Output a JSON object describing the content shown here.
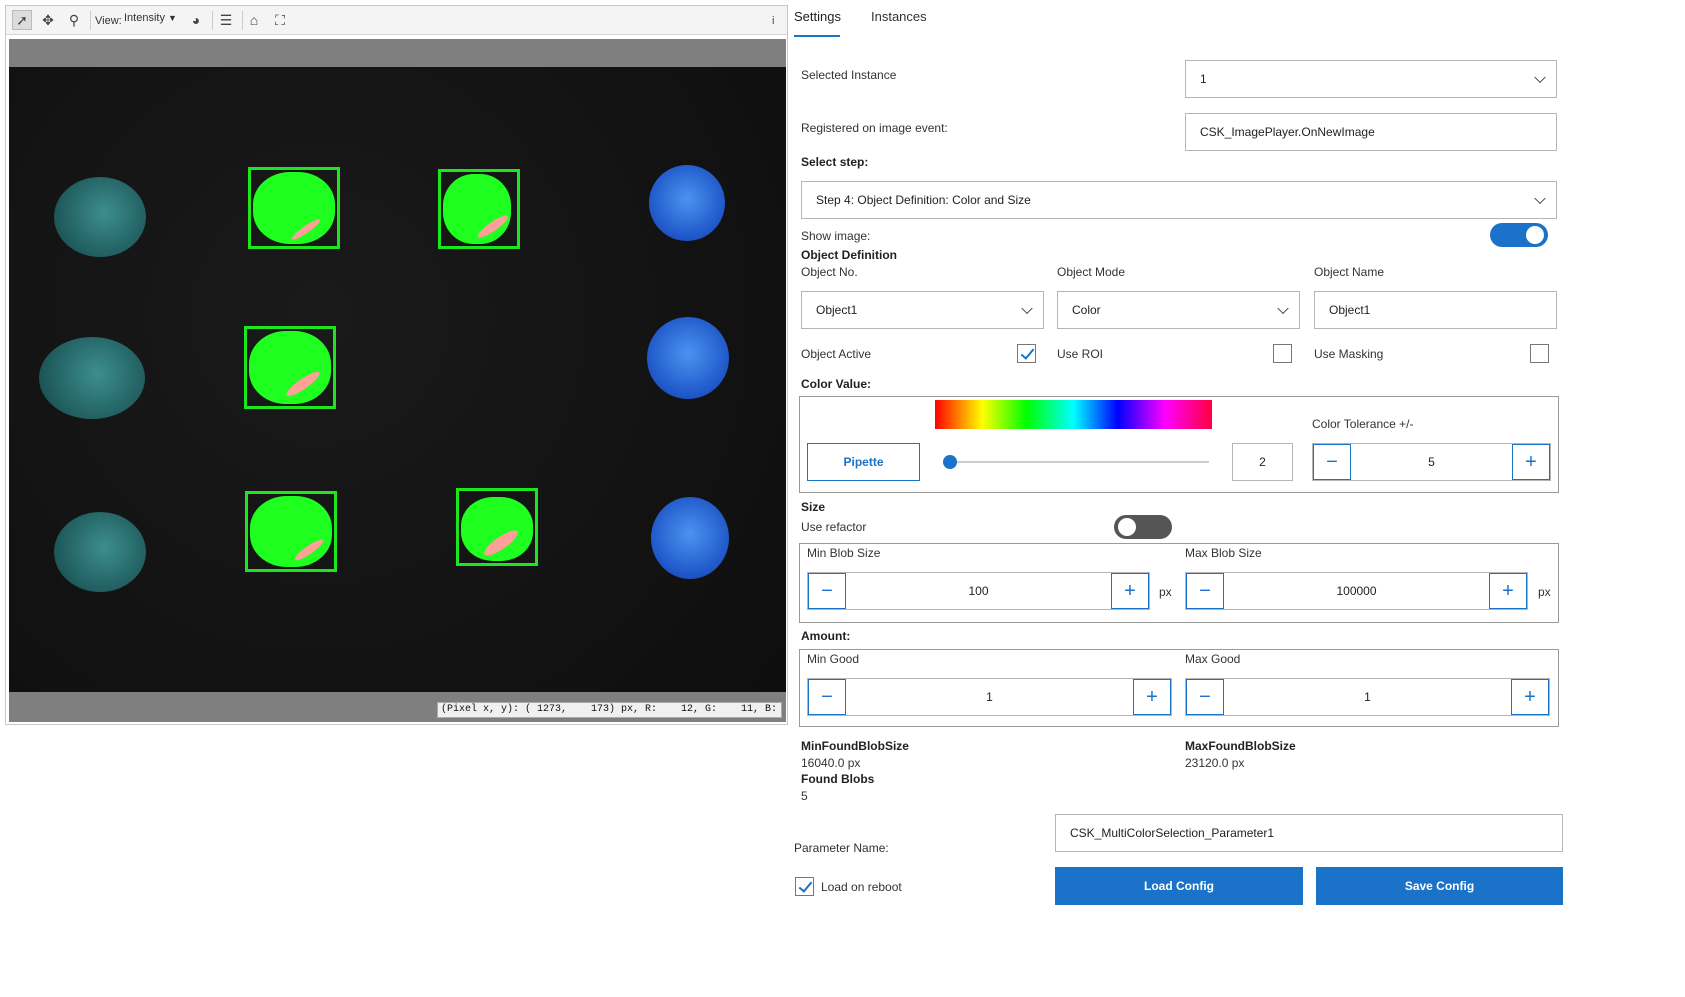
{
  "viewer": {
    "view_label": "View:",
    "view_mode": "Intensity",
    "info_label": "i",
    "status": "(Pixel x, y): ( 1273,    173) px, R:    12, G:    11, B:    17"
  },
  "tabs": [
    {
      "label": "Settings"
    },
    {
      "label": "Instances"
    }
  ],
  "selected_instance": {
    "label": "Selected Instance",
    "value": "1"
  },
  "registered_event": {
    "label": "Registered on image event:",
    "value": "CSK_ImagePlayer.OnNewImage"
  },
  "select_step": {
    "label": "Select step:",
    "value": "Step 4: Object Definition: Color and Size"
  },
  "show_image": {
    "label": "Show image:",
    "on": true
  },
  "object_definition": {
    "title": "Object Definition",
    "object_no_label": "Object No.",
    "object_no_value": "Object1",
    "object_mode_label": "Object Mode",
    "object_mode_value": "Color",
    "object_name_label": "Object Name",
    "object_name_value": "Object1",
    "object_active_label": "Object Active",
    "object_active": true,
    "use_roi_label": "Use ROI",
    "use_roi": false,
    "use_masking_label": "Use Masking",
    "use_masking": false
  },
  "color_value": {
    "title": "Color Value:",
    "pipette_label": "Pipette",
    "hue_value": "2",
    "hue_slider_fraction": 0.0,
    "tolerance_label": "Color Tolerance +/-",
    "tolerance_value": "5"
  },
  "size": {
    "title": "Size",
    "use_refactor_label": "Use refactor",
    "use_refactor": false,
    "min_blob_label": "Min Blob Size",
    "min_blob_value": "100",
    "max_blob_label": "Max Blob Size",
    "max_blob_value": "100000",
    "unit": "px"
  },
  "amount": {
    "title": "Amount:",
    "min_good_label": "Min Good",
    "min_good_value": "1",
    "max_good_label": "Max Good",
    "max_good_value": "1"
  },
  "results": {
    "min_found_label": "MinFoundBlobSize",
    "min_found_value": "16040.0 px",
    "max_found_label": "MaxFoundBlobSize",
    "max_found_value": "23120.0 px",
    "found_blobs_label": "Found Blobs",
    "found_blobs_value": "5"
  },
  "parameter": {
    "label": "Parameter Name:",
    "value": "CSK_MultiColorSelection_Parameter1",
    "load_on_reboot_label": "Load on reboot",
    "load_on_reboot": true,
    "load_button": "Load Config",
    "save_button": "Save Config"
  },
  "icons": {
    "minus": "−",
    "plus": "+"
  },
  "colors": {
    "accent": "#1a73c8",
    "detection": "#1ee61e"
  }
}
